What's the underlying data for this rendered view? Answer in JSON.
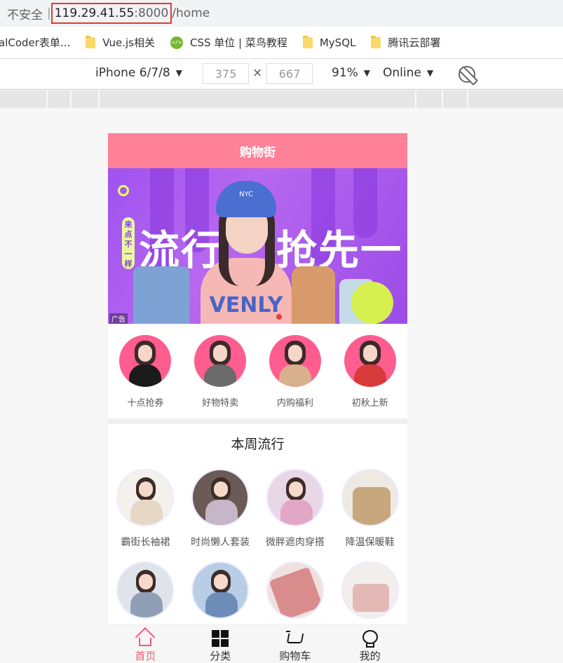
{
  "browser": {
    "security_label": "不安全",
    "separator": "|",
    "host": "119.29.41.55",
    "port": ":8000",
    "path": "/home"
  },
  "bookmarks": [
    {
      "label": "alCoder表单...",
      "icon": "none"
    },
    {
      "label": "Vue.js相关",
      "icon": "folder-icon"
    },
    {
      "label": "CSS 单位 | 菜鸟教程",
      "icon": "code-icon"
    },
    {
      "label": "MySQL",
      "icon": "folder-icon"
    },
    {
      "label": "腾讯云部署",
      "icon": "folder-icon"
    }
  ],
  "device_toolbar": {
    "device": "iPhone 6/7/8",
    "width": "375",
    "times": "×",
    "height": "667",
    "zoom": "91%",
    "network": "Online"
  },
  "app": {
    "nav_title": "购物街",
    "banner": {
      "badge_text": "来点不一样",
      "headline_left": "流行",
      "headline_right": "抢先一步",
      "hat_text": "NYC",
      "shirt_text": "VENLY",
      "ad_label": "广告"
    },
    "recommend": [
      {
        "label": "十点抢券",
        "shirt": "#1b1b1b"
      },
      {
        "label": "好物特卖",
        "shirt": "#6b6b6b"
      },
      {
        "label": "内购福利",
        "shirt": "#d9b08c"
      },
      {
        "label": "初秋上新",
        "shirt": "#d83a3a"
      }
    ],
    "week": {
      "title": "本周流行",
      "items": [
        {
          "label": "霸街长袖裙",
          "bg": "#f4f1ec",
          "cloth": "#e7d8c6"
        },
        {
          "label": "时尚懒人套装",
          "bg": "#6b5a55",
          "cloth": "#c7b6c8"
        },
        {
          "label": "微胖遮肉穿搭",
          "bg": "#e9d7e8",
          "cloth": "#e3a7c6"
        },
        {
          "label": "降温保暖鞋",
          "bg": "#eee9e2",
          "cloth": "#c7a77c"
        },
        {
          "label": "",
          "bg": "#dfe4ea",
          "cloth": "#8f9fb6"
        },
        {
          "label": "",
          "bg": "#b8cde6",
          "cloth": "#6d8cb8"
        },
        {
          "label": "",
          "bg": "#efe2de",
          "cloth": "#d98c8c"
        },
        {
          "label": "",
          "bg": "#f1eeec",
          "cloth": "#e3b9b6"
        }
      ]
    },
    "tabbar": [
      {
        "label": "首页",
        "icon": "home-icon",
        "active": true
      },
      {
        "label": "分类",
        "icon": "category-icon",
        "active": false
      },
      {
        "label": "购物车",
        "icon": "cart-icon",
        "active": false
      },
      {
        "label": "我的",
        "icon": "profile-icon",
        "active": false
      }
    ]
  }
}
